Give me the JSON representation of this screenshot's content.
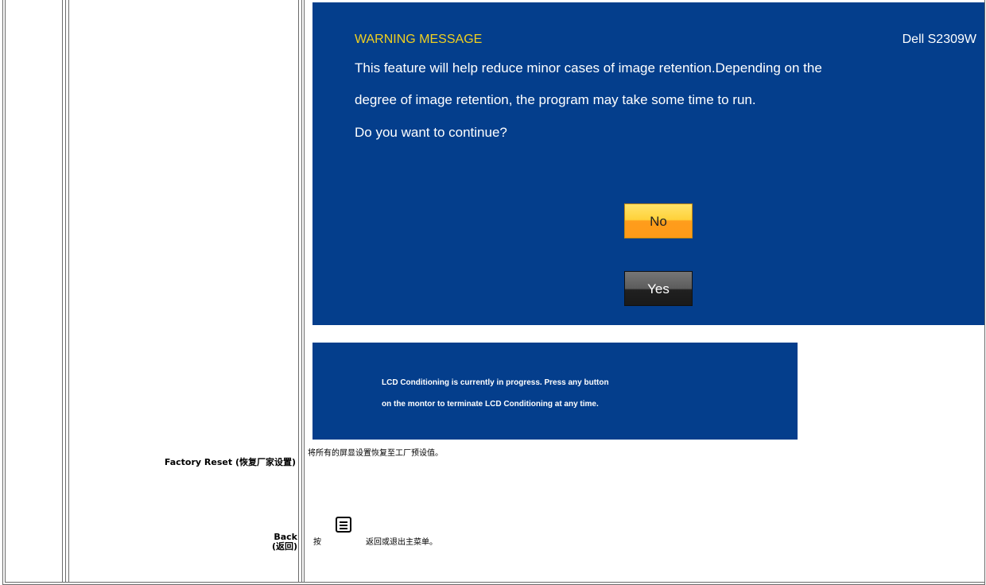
{
  "osd": {
    "title": "WARNING MESSAGE",
    "model": "Dell S2309W",
    "line1": "This feature will help reduce minor cases of image retention.Depending on the",
    "line2": "degree of image retention, the program may take some time to run.",
    "question": "Do you want to continue?",
    "no_label": "No",
    "yes_label": "Yes"
  },
  "banner": {
    "line1": "LCD Conditioning is currently in progress. Press any button",
    "line2": "on the montor to terminate LCD Conditioning at any time."
  },
  "rows": {
    "factory_reset": {
      "label": "Factory Reset (恢复厂家设置)",
      "desc": "将所有的屏显设置恢复至工厂预设值。"
    },
    "back": {
      "label_en": "Back",
      "label_cn": "(返回)",
      "desc_prefix": "按",
      "desc_suffix": "返回或退出主菜单。"
    }
  },
  "icons": {
    "menu": "menu-button-icon"
  },
  "colors": {
    "osd_bg": "#043e8c",
    "title": "#f0d020",
    "no_button": "#ffd23a",
    "yes_button": "#5c5c5c"
  }
}
